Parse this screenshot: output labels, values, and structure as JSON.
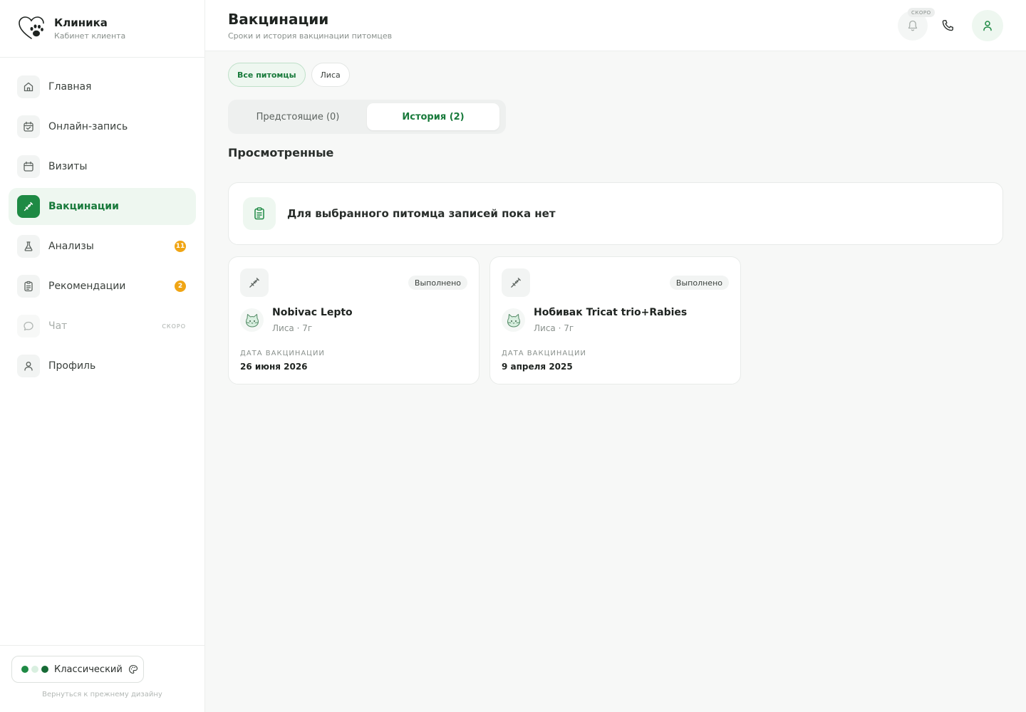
{
  "brand": {
    "title": "Клиника",
    "subtitle": "Кабинет клиента"
  },
  "colors": {
    "accent": "#1e8a44",
    "accent_light": "#eef7f0",
    "badge": "#f0a514"
  },
  "sidebar": {
    "items": [
      {
        "label": "Главная",
        "icon": "home-icon"
      },
      {
        "label": "Онлайн-запись",
        "icon": "calendar-check-icon"
      },
      {
        "label": "Визиты",
        "icon": "calendar-icon"
      },
      {
        "label": "Вакцинации",
        "icon": "syringe-icon",
        "active": true
      },
      {
        "label": "Анализы",
        "icon": "flask-icon",
        "badge": "11"
      },
      {
        "label": "Рекомендации",
        "icon": "clipboard-icon",
        "badge": "2"
      },
      {
        "label": "Чат",
        "icon": "chat-icon",
        "soon": "СКОРО"
      },
      {
        "label": "Профиль",
        "icon": "user-icon"
      }
    ]
  },
  "theme": {
    "label": "Классический",
    "back_link": "Вернуться к прежнему дизайну"
  },
  "header": {
    "title": "Вакцинации",
    "subtitle": "Сроки и история вакцинации питомцев",
    "soon": "СКОРО"
  },
  "filters": {
    "all_pets": "Все питомцы",
    "pet": "Лиса"
  },
  "tabs": {
    "upcoming": "Предстоящие (0)",
    "history": "История (2)"
  },
  "section_title": "Просмотренные",
  "empty_message": "Для выбранного питомца записей пока нет",
  "vaccinations": [
    {
      "name": "Nobivac Lepto",
      "pet": "Лиса · 7г",
      "status": "Выполнено",
      "date_label": "Дата вакцинации",
      "date": "26 июня 2026"
    },
    {
      "name": "Нобивак Tricat trio+Rabies",
      "pet": "Лиса · 7г",
      "status": "Выполнено",
      "date_label": "Дата вакцинации",
      "date": "9 апреля 2025"
    }
  ]
}
